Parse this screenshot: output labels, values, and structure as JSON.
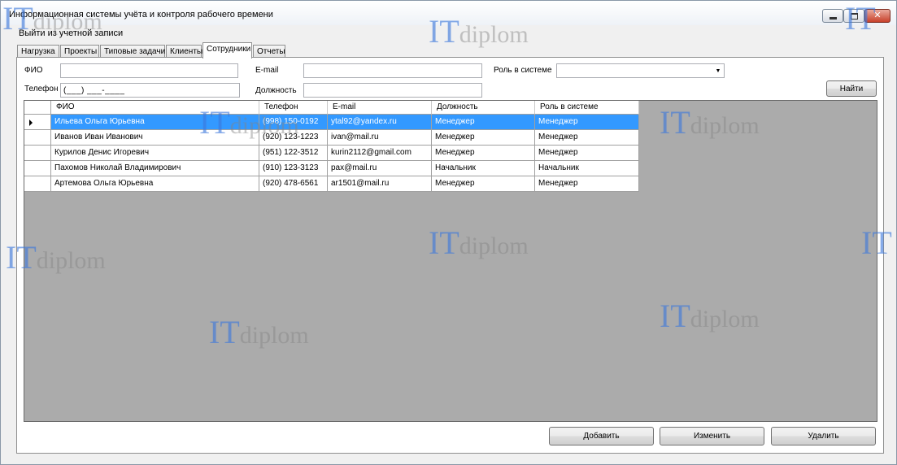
{
  "window": {
    "title": "Информационная системы учёта и контроля рабочего времени",
    "menu_logout": "Выйти из учетной записи"
  },
  "tabs": [
    {
      "label": "Нагрузка",
      "active": false
    },
    {
      "label": "Проекты",
      "active": false
    },
    {
      "label": "Типовые задачи",
      "active": false
    },
    {
      "label": "Клиенты",
      "active": false
    },
    {
      "label": "Сотрудники",
      "active": true
    },
    {
      "label": "Отчеты",
      "active": false
    }
  ],
  "filters": {
    "fio_label": "ФИО",
    "fio_value": "",
    "email_label": "E-mail",
    "email_value": "",
    "role_label": "Роль в системе",
    "role_value": "",
    "phone_label": "Телефон",
    "phone_mask": "(___) ___-____",
    "position_label": "Должность",
    "position_value": "",
    "search_button": "Найти"
  },
  "grid": {
    "columns": [
      "ФИО",
      "Телефон",
      "E-mail",
      "Должность",
      "Роль в системе"
    ],
    "rows": [
      {
        "fio": "Ильева Ольга Юрьевна",
        "phone": "(998) 150-0192",
        "email": "ytal92@yandex.ru",
        "position": "Менеджер",
        "role": "Менеджер",
        "selected": true
      },
      {
        "fio": "Иванов Иван Иванович",
        "phone": "(920) 123-1223",
        "email": "ivan@mail.ru",
        "position": "Менеджер",
        "role": "Менеджер",
        "selected": false
      },
      {
        "fio": "Курилов Денис Игоревич",
        "phone": "(951) 122-3512",
        "email": "kurin2112@gmail.com",
        "position": "Менеджер",
        "role": "Менеджер",
        "selected": false
      },
      {
        "fio": "Пахомов Николай Владимирович",
        "phone": "(910) 123-3123",
        "email": "pax@mail.ru",
        "position": "Начальник",
        "role": "Начальник",
        "selected": false
      },
      {
        "fio": "Артемова Ольга Юрьевна",
        "phone": "(920) 478-6561",
        "email": "ar1501@mail.ru",
        "position": "Менеджер",
        "role": "Менеджер",
        "selected": false
      }
    ]
  },
  "actions": {
    "add": "Добавить",
    "edit": "Изменить",
    "delete": "Удалить"
  },
  "watermark": {
    "it": "IT",
    "diplom": "diplom"
  },
  "icons": {
    "minimize": "minimize-icon",
    "maximize": "maximize-icon",
    "close": "close-icon",
    "dropdown": "chevron-down-icon",
    "current_row": "row-pointer-icon"
  }
}
